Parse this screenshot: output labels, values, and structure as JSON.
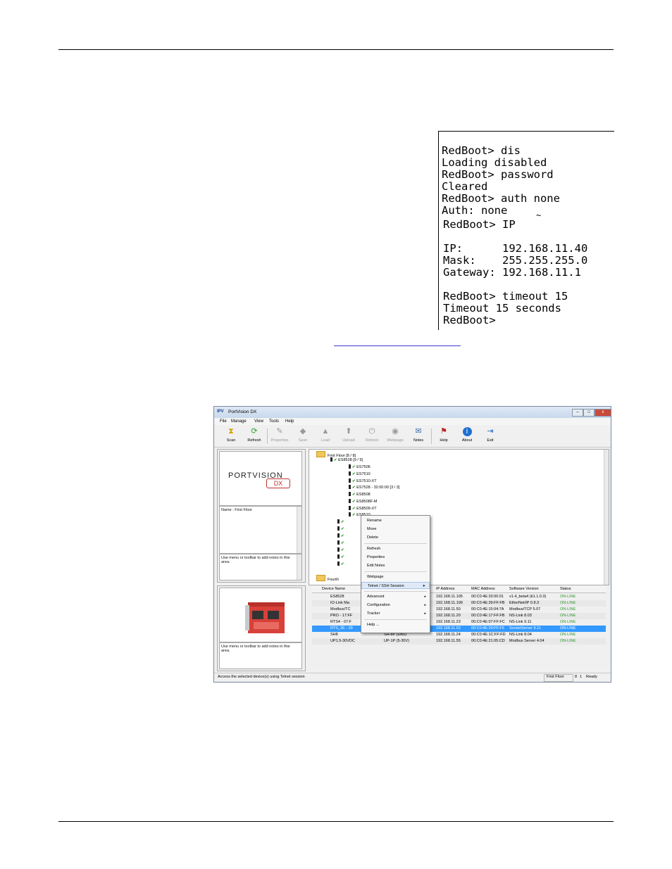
{
  "terminal": {
    "lines": [
      "RedBoot> dis",
      "Loading disabled",
      "RedBoot> password",
      "Cleared",
      "RedBoot> auth none",
      "Auth: none",
      "RedBoot> IP",
      "",
      "IP:      192.168.11.40",
      "Mask:    255.255.255.0",
      "Gateway: 192.168.11.1",
      "",
      "RedBoot> timeout 15",
      "Timeout 15 seconds",
      "RedBoot>"
    ],
    "stray_mark": "~"
  },
  "app": {
    "title": "PortVision DX",
    "title_logo": "IPV",
    "window_buttons": {
      "minimize": "–",
      "maximize": "□",
      "close": "x"
    },
    "menu": [
      "File",
      "Manage",
      "View",
      "Tools",
      "Help"
    ],
    "toolbar": [
      {
        "label": "Scan",
        "icon": "scan-icon",
        "enabled": true
      },
      {
        "label": "Refresh",
        "icon": "refresh-icon",
        "enabled": true
      },
      {
        "label": "Properties",
        "icon": "properties-icon",
        "enabled": false
      },
      {
        "label": "Save",
        "icon": "save-icon",
        "enabled": false
      },
      {
        "label": "Load",
        "icon": "load-icon",
        "enabled": false
      },
      {
        "label": "Upload",
        "icon": "upload-icon",
        "enabled": false
      },
      {
        "label": "Reboot",
        "icon": "reboot-icon",
        "enabled": false
      },
      {
        "label": "Webpage",
        "icon": "webpage-icon",
        "enabled": false
      },
      {
        "label": "Notes",
        "icon": "notes-icon",
        "enabled": true
      },
      {
        "label": "Help",
        "icon": "help-icon",
        "enabled": true
      },
      {
        "label": "About",
        "icon": "about-icon",
        "enabled": true
      },
      {
        "label": "Exit",
        "icon": "exit-icon",
        "enabled": true
      }
    ],
    "logo": {
      "text": "PORTVISION",
      "dx": "DX"
    },
    "name_panel": "Name : First Floor",
    "notes_hint": "Use menu or toolbar to add notes in this area.",
    "notes_hint2": "Use menu or toolbar to add notes in this area.",
    "tree": [
      "First Floor [8 / 8]",
      "ES8528 [9 / 9]",
      "ES7506",
      "ES7510",
      "ES7510-XT",
      "ES7528 - 32:00:00 [3 / 3]",
      "ES8508",
      "ES8508F-M",
      "ES8509-XT",
      "ES8510",
      "Fourth",
      "Fourth"
    ],
    "context_menu": {
      "items": [
        {
          "label": "Rename",
          "submenu": false
        },
        {
          "label": "Move",
          "submenu": false
        },
        {
          "label": "Delete",
          "submenu": false
        },
        {
          "label": "Refresh",
          "submenu": false
        },
        {
          "label": "Properties",
          "submenu": false
        },
        {
          "label": "Edit Notes",
          "submenu": false
        },
        {
          "label": "Webpage",
          "submenu": false
        },
        {
          "label": "Telnet / SSH Session",
          "submenu": false
        },
        {
          "label": "Advanced",
          "submenu": true
        },
        {
          "label": "Configuration",
          "submenu": true
        },
        {
          "label": "Tracker",
          "submenu": true
        },
        {
          "label": "Help ...",
          "submenu": false
        }
      ],
      "highlighted": "Telnet / SSH Session"
    },
    "grid": {
      "columns": [
        "Device Name",
        "IP Address",
        "MAC Address",
        "Software Version",
        "Status"
      ],
      "rows": [
        {
          "name": "ES8528",
          "model": "",
          "ip": "192.168.11.105",
          "mac": "00:C0:4E:33:00:01",
          "sw": "v1.4_beta4 (b1.1.0.3)",
          "status": "ON-LINE"
        },
        {
          "name": "IO-Link Ma",
          "model": "",
          "ip": "192.168.11.199",
          "mac": "00:C0:4E:39:FF:FB",
          "sw": "EtherNet/IP 0.8.3",
          "status": "ON-LINE"
        },
        {
          "name": "Modbus/TC",
          "model": "",
          "ip": "192.168.11.50",
          "mac": "00:C0:4E:15:04:7A",
          "sw": "Modbus/TCP 5.07",
          "status": "ON-LINE"
        },
        {
          "name": "PRO - 17:FF",
          "model": "",
          "ip": "192.168.11.20",
          "mac": "00:C0:4E:17:FF:FB",
          "sw": "NS-Link 8.03",
          "status": "ON-LINE"
        },
        {
          "name": "RTS4 - 07:F",
          "model": "",
          "ip": "192.168.11.23",
          "mac": "00:C0:4E:07:FF:FC",
          "sw": "NS-Link 9.11",
          "status": "ON-LINE"
        },
        {
          "name": "RTS_2E - 29",
          "model": "",
          "ip": "192.168.11.52",
          "mac": "00:C0:4E:29:FF:F5",
          "sw": "SocketServer 9.11",
          "status": "ON-LINE"
        },
        {
          "name": "SH8",
          "model": "SH-8P (DB0)",
          "ip": "192.168.11.24",
          "mac": "00:C0:4E:1C:FF:FD",
          "sw": "NS-Link 8.04",
          "status": "ON-LINE"
        },
        {
          "name": "UP1.5-30VDC",
          "model": "UP-1P (5-30V)",
          "ip": "192.168.11.55",
          "mac": "00:C0:4E:21:05:CD",
          "sw": "Modbus Server 4.04",
          "status": "ON-LINE"
        }
      ],
      "selected_row": 5
    },
    "statusbar": {
      "message": "Access the selected device(s) using Telnet session",
      "location": "First Floor",
      "count_a": "8",
      "count_b": "1",
      "state": "Ready"
    },
    "colors": {
      "selection": "#3399ff",
      "online": "#2a9a2a",
      "accent_red": "#c03030"
    }
  }
}
